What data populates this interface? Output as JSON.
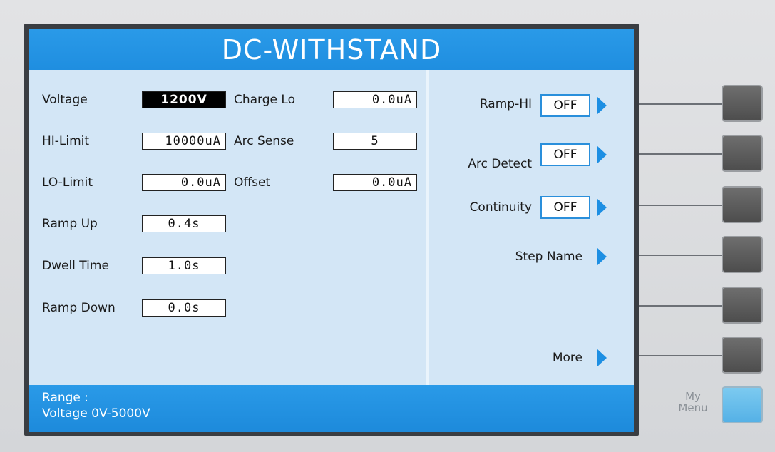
{
  "title": "DC-WITHSTAND",
  "left_params": [
    {
      "label": "Voltage",
      "value": "1200V",
      "selected": true
    },
    {
      "label": "HI-Limit",
      "value": "10000uA"
    },
    {
      "label": "LO-Limit",
      "value": "0.0uA"
    },
    {
      "label": "Ramp Up",
      "value": "0.4s"
    },
    {
      "label": "Dwell Time",
      "value": "1.0s"
    },
    {
      "label": "Ramp Down",
      "value": "0.0s"
    }
  ],
  "mid_params": [
    {
      "label": "Charge Lo",
      "value": "0.0uA"
    },
    {
      "label": "Arc Sense",
      "value": "5"
    },
    {
      "label": "Offset",
      "value": "0.0uA"
    }
  ],
  "softkeys": [
    {
      "label": "Ramp-HI",
      "value": "OFF"
    },
    {
      "label": "Arc Detect",
      "value": "OFF"
    },
    {
      "label": "Continuity",
      "value": "OFF"
    },
    {
      "label": "Step Name"
    },
    {
      "label": "More"
    }
  ],
  "status": {
    "line1": "Range :",
    "line2": "Voltage 0V-5000V"
  },
  "hardware": {
    "my_menu_line1": "My",
    "my_menu_line2": "Menu"
  },
  "colors": {
    "header_blue": "#1f8ee0",
    "panel": "#d3e6f6",
    "selection": "#000000"
  }
}
